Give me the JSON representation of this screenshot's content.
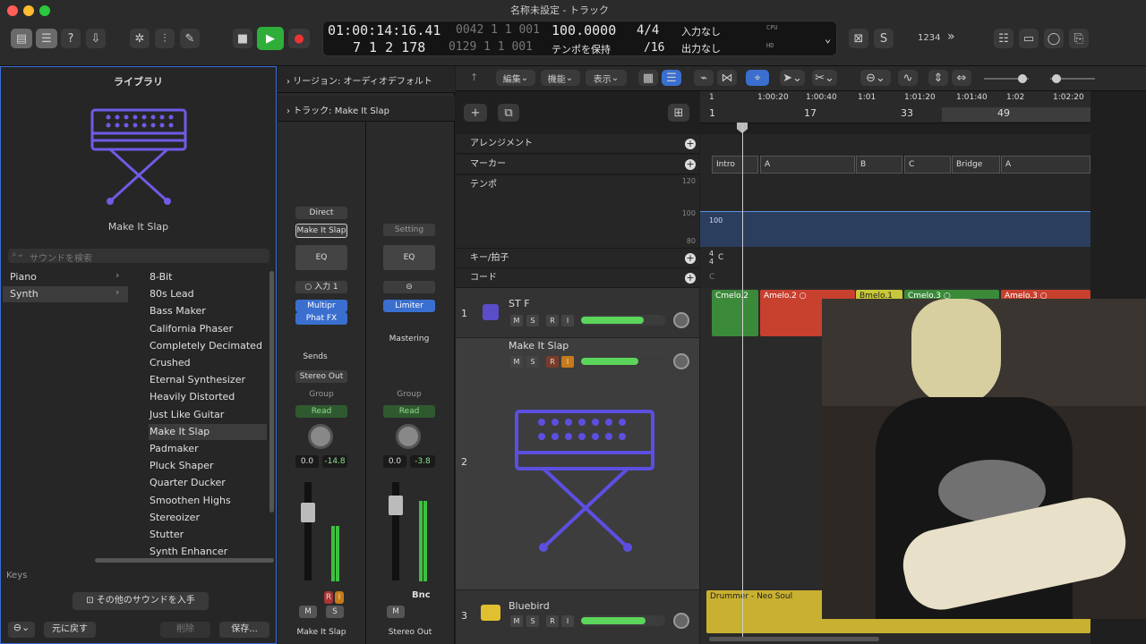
{
  "window": {
    "title": "名称未設定 - トラック"
  },
  "transport": {
    "time": "01:00:14:16.41",
    "bars": "7  1  2  178",
    "sub1": "0042  1  1  001",
    "sub2": "0129  1  1  001",
    "tempo": "100.0000",
    "tempo_mode": "テンポを保持",
    "sig": "4/4",
    "div": "/16",
    "input": "入力なし",
    "output": "出力なし",
    "cpu": "CPU",
    "hd": "HD",
    "count": "1234"
  },
  "library": {
    "title": "ライブラリ",
    "patch_name": "Make It Slap",
    "search_placeholder": "サウンドを検索",
    "categories": [
      "Piano",
      "Synth"
    ],
    "items": [
      "8-Bit",
      "80s Lead",
      "Bass Maker",
      "California Phaser",
      "Completely Decimated",
      "Crushed",
      "Eternal Synthesizer",
      "Heavily Distorted",
      "Just Like Guitar",
      "Make It Slap",
      "Padmaker",
      "Pluck Shaper",
      "Quarter Ducker",
      "Smoothen Highs",
      "Stereoizer",
      "Stutter",
      "Synth Enhancer"
    ],
    "selected": "Make It Slap",
    "keys": "Keys",
    "get_more": "その他のサウンドを入手",
    "revert": "元に戻す",
    "delete": "削除",
    "save": "保存..."
  },
  "inspector": {
    "region": "リージョン: オーディオデフォルト",
    "track": "トラック:",
    "track_name": "Make It Slap"
  },
  "strip1": {
    "setting": "Direct",
    "patch": "Make It Slap",
    "eq": "EQ",
    "input": "入力 1",
    "fx1": "Multipr",
    "fx2": "Phat FX",
    "sends": "Sends",
    "out": "Stereo Out",
    "group": "Group",
    "auto": "Read",
    "pan": "0.0",
    "vol": "-14.8",
    "m": "M",
    "s": "S",
    "r": "R",
    "i": "I",
    "name": "Make It Slap"
  },
  "strip2": {
    "setting": "Setting",
    "eq": "EQ",
    "fx1": "Limiter",
    "fx2": "Mastering",
    "group": "Group",
    "auto": "Read",
    "pan": "0.0",
    "vol": "-3.8",
    "bnc": "Bnc",
    "m": "M",
    "name": "Stereo Out"
  },
  "toolbar": {
    "edit": "編集",
    "function": "機能",
    "view": "表示"
  },
  "ruler": {
    "times": [
      "1",
      "1:00:20",
      "1:00:40",
      "1:01",
      "1:01:20",
      "1:01:40",
      "1:02",
      "1:02:20"
    ],
    "bars": [
      "1",
      "17",
      "33",
      "49"
    ]
  },
  "global": {
    "arrangement": "アレンジメント",
    "marker": "マーカー",
    "tempo": "テンポ",
    "key": "キー/拍子",
    "chord": "コード",
    "t120": "120",
    "t100": "100",
    "t80": "80",
    "tval": "100",
    "sig": "4/4",
    "key_val": "C",
    "chord_val": "C"
  },
  "markers": [
    "Intro",
    "A",
    "B",
    "C",
    "Bridge",
    "A"
  ],
  "tracks": [
    {
      "num": "1",
      "name": "ST F"
    },
    {
      "num": "",
      "name": "Make It Slap"
    },
    {
      "num": "2",
      "name": ""
    },
    {
      "num": "3",
      "name": "Bluebird"
    }
  ],
  "regions": [
    "Cmelo.2",
    "Amelo.2",
    "Bmelo.1",
    "Cmelo.3",
    "Amelo.3",
    "Drummer - Neo Soul"
  ]
}
